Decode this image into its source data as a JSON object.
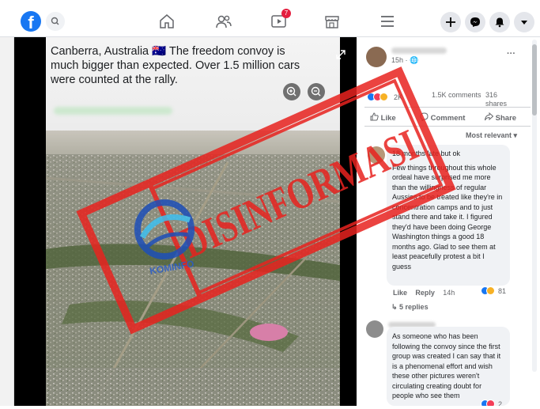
{
  "header": {
    "logo": "f",
    "notification_count": "7",
    "icons": [
      "search-icon",
      "home-icon",
      "friends-icon",
      "watch-icon",
      "marketplace-icon",
      "menu-icon",
      "plus-icon",
      "messenger-icon",
      "bell-icon",
      "caret-down-icon"
    ]
  },
  "post": {
    "caption": "Canberra, Australia 🇦🇺 The freedom convoy is much bigger than expected. Over 1.5 million cars were counted at the rally.",
    "time": "15h",
    "reaction_count": "2K",
    "comments_count": "1.5K comments",
    "shares_count": "316 shares",
    "like_label": "Like",
    "comment_label": "Comment",
    "share_label": "Share",
    "sort_label": "Most relevant",
    "more_label": "···"
  },
  "comments": [
    {
      "short_text": "18 months late but ok",
      "text": "Few things throughout this whole ordeal have surprised me more than the willingness of regular Aussies to be treated like they're in concentration camps and to just stand there and take it. I figured they'd have been doing George Washington things a good 18 months ago. Glad to see them at least peacefully protest a bit I guess",
      "like_label": "Like",
      "reply_label": "Reply",
      "time": "14h",
      "reactions": "81",
      "replies_label": "5 replies"
    },
    {
      "text": "As someone who has been following the convoy since the first group was created I can say that it is a phenomenal effort and wish these other pictures weren't circulating creating doubt for people who see them",
      "reactions": "2"
    }
  ],
  "stamp": {
    "text": "DISINFORMASI",
    "logo_text": "KOMINFO",
    "color": "#e8231f"
  },
  "colors": {
    "brand": "#1877f2",
    "badge": "#e41e3f"
  }
}
